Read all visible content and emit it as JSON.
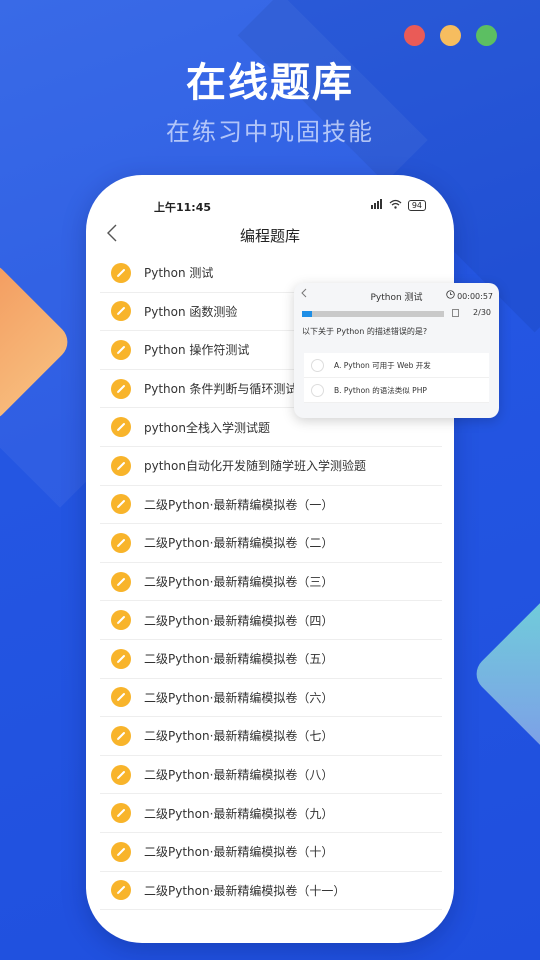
{
  "colors": {
    "background": "#2456e2",
    "accent_orange": "#f8b42b",
    "progress_blue": "#1e8ee6",
    "dot_red": "#ea5b57",
    "dot_yellow": "#f6bd5f",
    "dot_green": "#5cbf62"
  },
  "promo": {
    "headline": "在线题库",
    "subline": "在练习中巩固技能"
  },
  "statusbar": {
    "time": "上午11:45",
    "signal_icon": "signal-hd-icon",
    "wifi_icon": "wifi-icon",
    "battery": "94"
  },
  "nav": {
    "back_icon": "chevron-left-icon",
    "title": "编程题库"
  },
  "list": {
    "icon": "pencil-icon",
    "items": [
      {
        "label": "Python 测试"
      },
      {
        "label": "Python 函数测验"
      },
      {
        "label": "Python 操作符测试"
      },
      {
        "label": "Python 条件判断与循环测试"
      },
      {
        "label": "python全栈入学测试题"
      },
      {
        "label": "python自动化开发随到随学班入学测验题"
      },
      {
        "label": "二级Python·最新精编模拟卷（一）"
      },
      {
        "label": "二级Python·最新精编模拟卷（二）"
      },
      {
        "label": "二级Python·最新精编模拟卷（三）"
      },
      {
        "label": "二级Python·最新精编模拟卷（四）"
      },
      {
        "label": "二级Python·最新精编模拟卷（五）"
      },
      {
        "label": "二级Python·最新精编模拟卷（六）"
      },
      {
        "label": "二级Python·最新精编模拟卷（七）"
      },
      {
        "label": "二级Python·最新精编模拟卷（八）"
      },
      {
        "label": "二级Python·最新精编模拟卷（九）"
      },
      {
        "label": "二级Python·最新精编模拟卷（十）"
      },
      {
        "label": "二级Python·最新精编模拟卷（十一）"
      }
    ]
  },
  "quiz_card": {
    "back_icon": "chevron-left-icon",
    "title": "Python 测试",
    "timer_icon": "clock-icon",
    "timer": "00:00:57",
    "progress_fraction": 0.067,
    "answer_sheet_icon": "answer-sheet-icon",
    "progress_count": "2/30",
    "question": "以下关于 Python 的描述错误的是?",
    "options": [
      {
        "label": "A. Python 可用于 Web 开发"
      },
      {
        "label": "B. Python 的语法类似 PHP"
      }
    ]
  }
}
